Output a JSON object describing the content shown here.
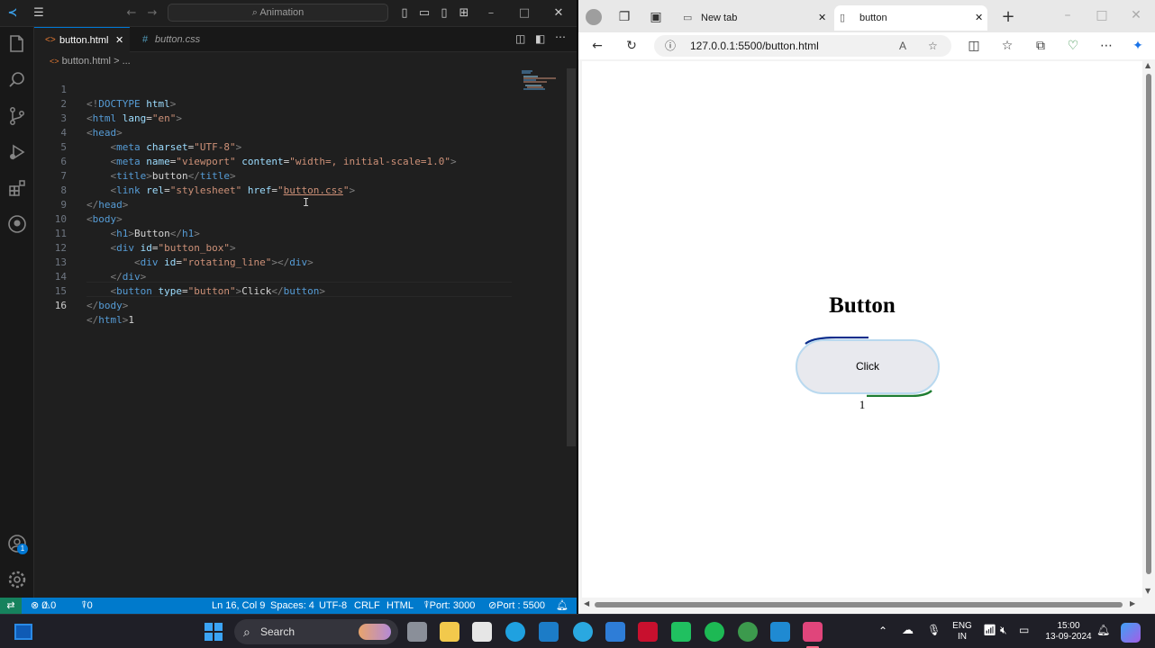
{
  "vscode": {
    "command_center": "Animation",
    "tabs": [
      {
        "label": "button.html",
        "active": true
      },
      {
        "label": "button.css",
        "active": false
      }
    ],
    "breadcrumb": {
      "file": "button.html",
      "sep": ">",
      "more": "..."
    },
    "code_lines": [
      {
        "n": "1"
      },
      {
        "n": "2"
      },
      {
        "n": "3"
      },
      {
        "n": "4"
      },
      {
        "n": "5"
      },
      {
        "n": "6"
      },
      {
        "n": "7"
      },
      {
        "n": "8"
      },
      {
        "n": "9"
      },
      {
        "n": "10"
      },
      {
        "n": "11"
      },
      {
        "n": "12"
      },
      {
        "n": "13"
      },
      {
        "n": "14"
      },
      {
        "n": "15"
      },
      {
        "n": "16"
      }
    ],
    "code": {
      "l1": {
        "open": "<!",
        "doctype": "DOCTYPE",
        "space": " ",
        "html": "html",
        "close": ">"
      },
      "l2": {
        "tag": "html",
        "attr": "lang",
        "val": "\"en\""
      },
      "l3": {
        "tag": "head"
      },
      "l4": {
        "tag": "meta",
        "attr": "charset",
        "val": "\"UTF-8\""
      },
      "l5": {
        "tag": "meta",
        "attr1": "name",
        "val1": "\"viewport\"",
        "attr2": "content",
        "val2": "\"width=, initial-scale=1.0\""
      },
      "l6": {
        "tag": "title",
        "text": "button"
      },
      "l7": {
        "tag": "link",
        "attr1": "rel",
        "val1": "\"stylesheet\"",
        "attr2": "href",
        "val2_q": "\"",
        "val2": "button.css"
      },
      "l8": {
        "tag": "head"
      },
      "l9": {
        "tag": "body"
      },
      "l10": {
        "tag": "h1",
        "text": "Button"
      },
      "l11": {
        "tag": "div",
        "attr": "id",
        "val": "\"button_box\""
      },
      "l12": {
        "tag": "div",
        "attr": "id",
        "val": "\"rotating_line\""
      },
      "l13": {
        "tag": "div"
      },
      "l14": {
        "tag": "button",
        "attr": "type",
        "val": "\"button\"",
        "text": "Click"
      },
      "l15": {
        "tag": "body"
      },
      "l16": {
        "tag": "html",
        "text": "1"
      }
    },
    "status": {
      "problems_errors": "0",
      "problems_warnings": "0",
      "ports": "0",
      "cursor": "Ln 16, Col 9",
      "spaces": "Spaces: 4",
      "encoding": "UTF-8",
      "eol": "CRLF",
      "language": "HTML",
      "port_live": "Port: 3000",
      "port_server": "Port : 5500",
      "accounts_badge": "1"
    }
  },
  "edge": {
    "tabs": [
      {
        "label": "New tab"
      },
      {
        "label": "button"
      }
    ],
    "url": "127.0.0.1:5500/button.html",
    "page": {
      "heading": "Button",
      "button_label": "Click",
      "text_after": "1"
    }
  },
  "taskbar": {
    "search_label": "Search",
    "language": "ENG",
    "region": "IN",
    "time": "15:00",
    "date": "13-09-2024"
  },
  "colors": {
    "vscode_status": "#007acc",
    "vscode_bg": "#1f1f1f",
    "edge_bg": "#f3f3f3",
    "button_fill": "#e8e9ee",
    "rotating_line_blue": "#0a2d8c",
    "rotating_line_green": "#1e7d32"
  }
}
